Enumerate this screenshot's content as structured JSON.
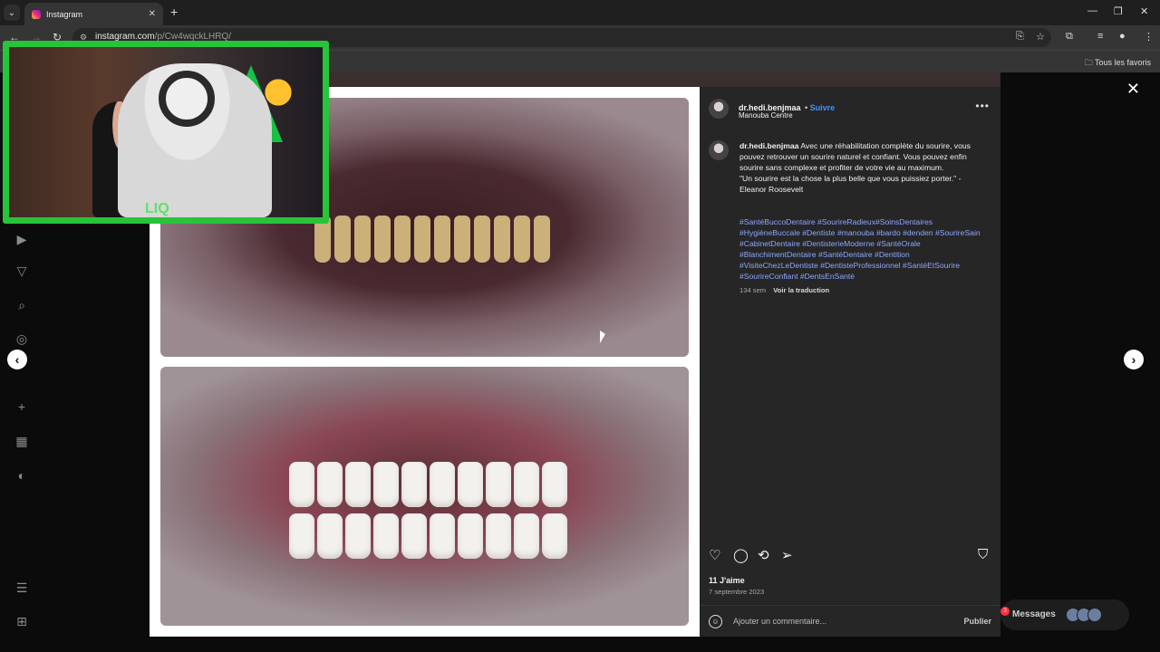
{
  "browser": {
    "tab_title": "Instagram",
    "url_host": "instagram.com",
    "url_path": "/p/Cw4wqckLHRQ/",
    "bookmarks_label": "Tous les favoris"
  },
  "post": {
    "username": "dr.hedi.benjmaa",
    "follow_label": "Suivre",
    "location": "Manouba Centre",
    "caption_user": "dr.hedi.benjmaa",
    "caption_text": "Avec une réhabilitation complète du sourire, vous pouvez retrouver un sourire naturel et confiant. Vous pouvez enfin sourire sans complexe et profiter de votre vie au maximum.",
    "caption_quote": "\"Un sourire est la chose la plus belle que vous puissiez porter.\" - Eleanor Roosevelt",
    "hashtags": "#SantéBuccoDentaire #SourireRadieux#SoinsDentaires #HygièneBuccale #Dentiste #manouba #bardo #denden #SourireSain #CabinetDentaire #DentisterieModerne #SantéOrale #BlanchimentDentaire #SantéDentaire #Dentition #VisiteChezLeDentiste #DentisteProfessionnel #SantéEtSourire #SourireConfiant #DentsEnSanté",
    "age": "134 sem",
    "translate_label": "Voir la traduction",
    "likes": "11 J'aime",
    "date": "7 septembre 2023",
    "comment_placeholder": "Ajouter un commentaire...",
    "publish_label": "Publier"
  },
  "messages": {
    "label": "Messages",
    "badge": "3"
  },
  "webcam_logo": "LIQ"
}
